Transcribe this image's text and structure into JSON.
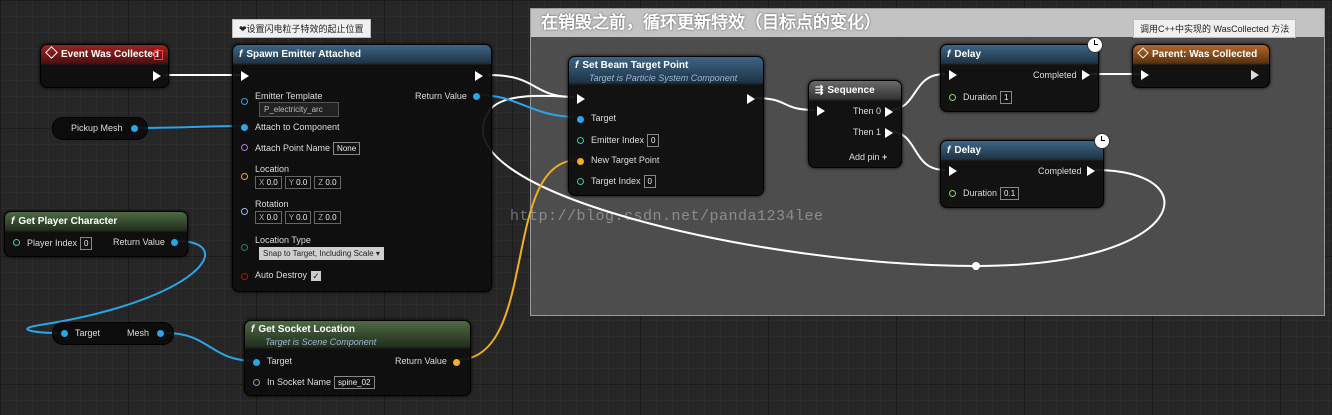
{
  "comment_box": {
    "title": "在销毁之前，循环更新特效（目标点的变化）"
  },
  "tooltips": {
    "spawn": "❤设置闪电粒子特效的起止位置",
    "parent": "调用C++中实现的 WasCollected 方法"
  },
  "watermark": "http://blog.csdn.net/panda1234lee",
  "nodes": {
    "event": {
      "title": "Event Was Collected"
    },
    "spawn": {
      "title": "Spawn Emitter Attached",
      "emitter_template_label": "Emitter Template",
      "emitter_template_value": "P_electricity_arc",
      "return_value_label": "Return Value",
      "attach_label": "Attach to Component",
      "attach_point_label": "Attach Point Name",
      "attach_point_value": "None",
      "location_label": "Location",
      "rotation_label": "Rotation",
      "vec_x": "X",
      "vec_y": "Y",
      "vec_z": "Z",
      "vec_zero": "0.0",
      "location_type_label": "Location Type",
      "location_type_value": "Snap to Target, Including Scale",
      "auto_destroy_label": "Auto Destroy"
    },
    "pickup_mesh": {
      "label": "Pickup Mesh"
    },
    "get_player": {
      "title": "Get Player Character",
      "player_index_label": "Player Index",
      "player_index_value": "0",
      "return_value_label": "Return Value"
    },
    "target_mesh": {
      "target_label": "Target",
      "mesh_label": "Mesh"
    },
    "get_socket": {
      "title": "Get Socket Location",
      "subtitle": "Target is Scene Component",
      "target_label": "Target",
      "return_value_label": "Return Value",
      "socket_label": "In Socket Name",
      "socket_value": "spine_02"
    },
    "set_beam": {
      "title": "Set Beam Target Point",
      "subtitle": "Target is Particle System Component",
      "target_label": "Target",
      "emitter_index_label": "Emitter Index",
      "emitter_index_value": "0",
      "new_target_label": "New Target Point",
      "target_index_label": "Target Index",
      "target_index_value": "0"
    },
    "sequence": {
      "title": "Sequence",
      "then0": "Then 0",
      "then1": "Then 1",
      "add_pin": "Add pin"
    },
    "delay1": {
      "title": "Delay",
      "completed": "Completed",
      "duration_label": "Duration",
      "duration_value": "1"
    },
    "delay2": {
      "title": "Delay",
      "completed": "Completed",
      "duration_label": "Duration",
      "duration_value": "0.1"
    },
    "parent": {
      "title": "Parent: Was Collected"
    }
  }
}
